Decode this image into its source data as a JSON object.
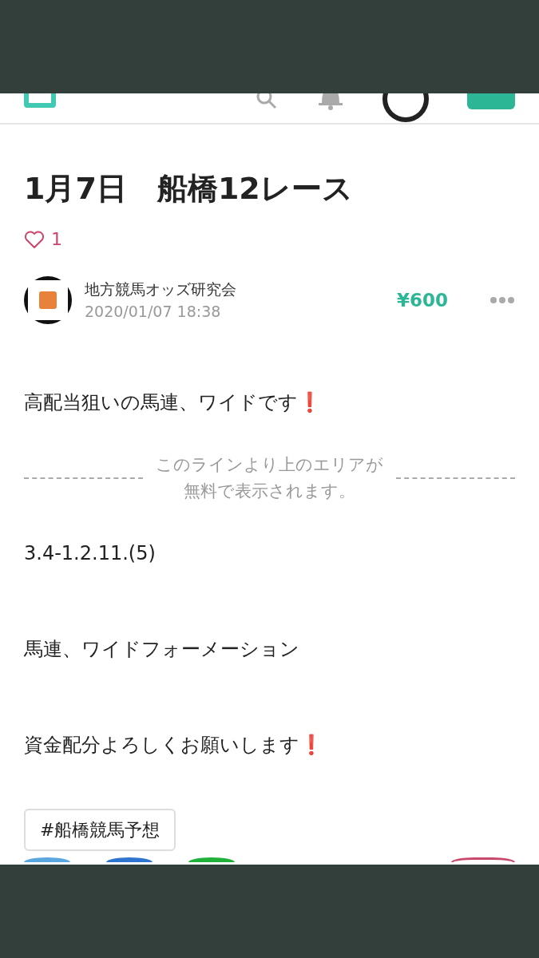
{
  "article": {
    "title": "1月7日　船橋12レース",
    "likes": "1",
    "liked": false,
    "author": {
      "name": "地方競馬オッズ研究会",
      "date": "2020/01/07 18:38"
    },
    "price": "¥600",
    "paragraphs": [
      {
        "kind": "text",
        "text": "高配当狙いの馬連、ワイドです❗"
      },
      {
        "kind": "paywall",
        "lines": [
          "このラインより上のエリアが",
          "無料で表示されます。"
        ]
      },
      {
        "kind": "text",
        "text": "3.4-1.2.11.(5)"
      },
      {
        "kind": "text",
        "text": "馬連、ワイドフォーメーション"
      },
      {
        "kind": "text",
        "text": "資金配分よろしくお願いします❗"
      }
    ],
    "tags": [
      "#船橋競馬予想"
    ]
  }
}
